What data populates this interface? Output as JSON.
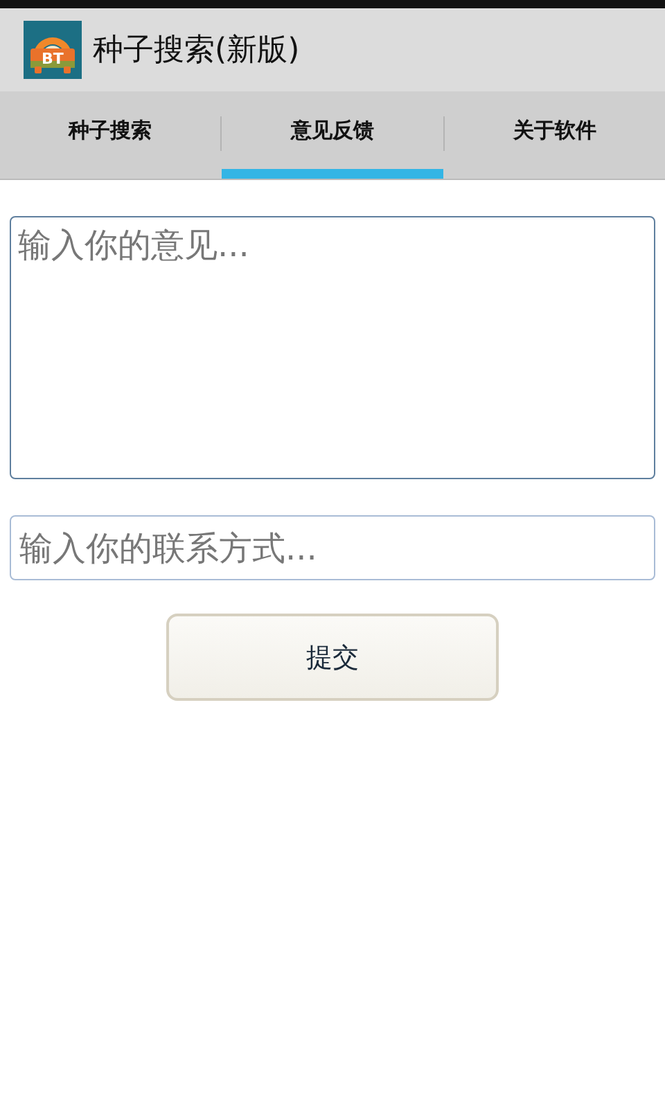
{
  "app_bar": {
    "icon_text": "BT",
    "title": "种子搜索(新版)"
  },
  "tabs": [
    {
      "label": "种子搜索",
      "selected": false
    },
    {
      "label": "意见反馈",
      "selected": true
    },
    {
      "label": "关于软件",
      "selected": false
    }
  ],
  "feedback_field": {
    "placeholder": "输入你的意见..."
  },
  "contact_field": {
    "placeholder": "输入你的联系方式..."
  },
  "submit_button": "提交"
}
